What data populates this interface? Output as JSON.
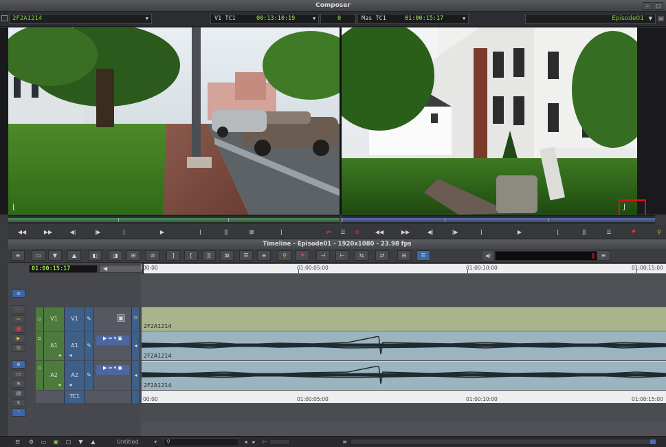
{
  "composer": {
    "title": "Composer",
    "clip_name": "2F2A1214",
    "v1_tc_label": "V1 TC1",
    "v1_tc_value": "00:13:10:19",
    "zero_value": "0",
    "mas_tc_label": "Mas TC1",
    "mas_tc_value": "01:00:15:17",
    "sequence_name": "Episode01",
    "colors": {
      "tc_green": "#9be84a",
      "highlight_red": "#e0101a",
      "source_bar": "#4f8a5a",
      "record_bar": "#5a6fa0"
    }
  },
  "timeline": {
    "title": "Timeline - Episode01 - 1920x1080 - 23.98 fps",
    "current_tc": "01:00:15:17",
    "ruler_ticks": [
      "00:00",
      "01:00:05:00",
      "01:00:10:00",
      "01:00:15:00"
    ],
    "tracks": [
      {
        "rec": "V1",
        "src": "V1",
        "clip": "2F2A1214",
        "kind": "video"
      },
      {
        "rec": "A1",
        "src": "A1",
        "clip": "2F2A1214",
        "kind": "audio"
      },
      {
        "rec": "A2",
        "src": "A2",
        "clip": "2F2A1214",
        "kind": "audio"
      },
      {
        "rec": "TC1",
        "kind": "timecode"
      }
    ]
  },
  "statusbar": {
    "bin_name": "Untitled"
  }
}
